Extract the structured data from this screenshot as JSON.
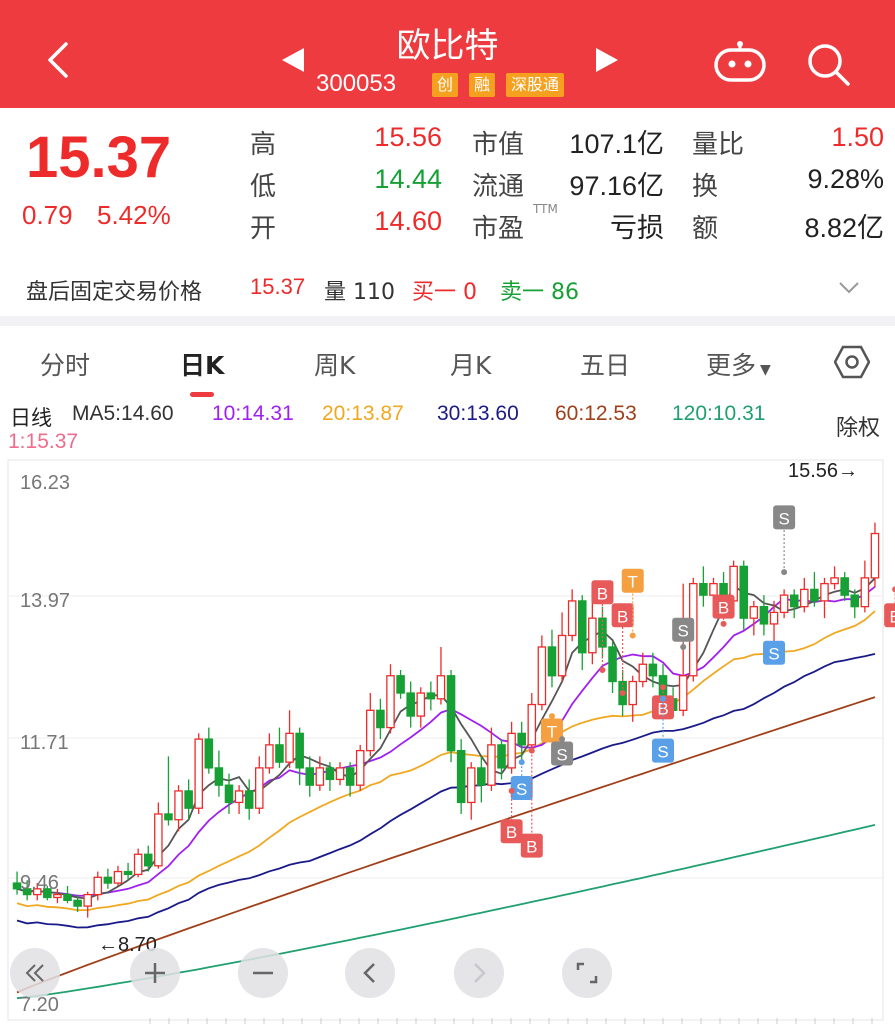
{
  "header": {
    "title": "欧比特",
    "code": "300053",
    "tags": [
      "创",
      "融",
      "深股通"
    ]
  },
  "quote": {
    "price": "15.37",
    "change": "0.79",
    "change_pct": "5.42%",
    "high_label": "高",
    "high": "15.56",
    "low_label": "低",
    "low": "14.44",
    "open_label": "开",
    "open": "14.60",
    "mktcap_label": "市值",
    "mktcap": "107.1亿",
    "float_label": "流通",
    "float": "97.16亿",
    "pe_label": "市盈",
    "pe_sup": "TTM",
    "pe": "亏损",
    "volratio_label": "量比",
    "volratio": "1.50",
    "turnover_label": "换",
    "turnover": "9.28%",
    "amount_label": "额",
    "amount": "8.82亿"
  },
  "after_hours": {
    "label": "盘后固定交易价格",
    "price": "15.37",
    "vol_label": "量 110",
    "buy1": "买一 0",
    "sell1": "卖一 86"
  },
  "tabs": [
    "分时",
    "日K",
    "周K",
    "月K",
    "五日",
    "更多"
  ],
  "active_tab": "日K",
  "ma_legend": {
    "period": "日线",
    "ma5": "MA5:14.60",
    "ma10": "10:14.31",
    "ma20": "20:13.87",
    "ma30": "30:13.60",
    "ma60": "60:12.53",
    "ma120": "120:10.31",
    "ma1": "1:15.37",
    "adjust": "除权"
  },
  "colors": {
    "up": "#ee2b2b",
    "down": "#17a035",
    "ma5": "#555555",
    "ma10": "#a020f0",
    "ma20": "#f0a820",
    "ma30": "#1a1a8a",
    "ma60": "#a0401a",
    "ma120": "#20a070",
    "ma1": "#ee6c8c"
  },
  "chart_data": {
    "type": "candlestick",
    "y_tick_labels": [
      "16.23",
      "13.97",
      "11.71",
      "9.46",
      "7.20"
    ],
    "ylim": [
      7.2,
      16.23
    ],
    "max_label": "15.56→",
    "min_label": "←8.70",
    "signal_markers": [
      "B",
      "S",
      "T"
    ],
    "candles": [
      [
        9.3,
        9.2,
        9.5,
        9.1
      ],
      [
        9.2,
        9.1,
        9.35,
        9.0
      ],
      [
        9.1,
        9.2,
        9.3,
        9.0
      ],
      [
        9.2,
        9.05,
        9.25,
        9.0
      ],
      [
        9.05,
        9.1,
        9.2,
        8.95
      ],
      [
        9.1,
        9.0,
        9.25,
        8.95
      ],
      [
        9.0,
        8.9,
        9.1,
        8.8
      ],
      [
        8.9,
        9.1,
        9.15,
        8.7
      ],
      [
        9.1,
        9.4,
        9.5,
        9.0
      ],
      [
        9.4,
        9.3,
        9.55,
        9.2
      ],
      [
        9.3,
        9.5,
        9.6,
        9.25
      ],
      [
        9.5,
        9.45,
        9.65,
        9.35
      ],
      [
        9.45,
        9.8,
        9.9,
        9.4
      ],
      [
        9.8,
        9.6,
        9.95,
        9.5
      ],
      [
        9.6,
        10.5,
        10.7,
        9.55
      ],
      [
        10.5,
        10.4,
        11.5,
        10.3
      ],
      [
        10.4,
        10.9,
        11.0,
        10.2
      ],
      [
        10.9,
        10.6,
        11.1,
        10.4
      ],
      [
        10.6,
        11.8,
        11.9,
        10.5
      ],
      [
        11.8,
        11.3,
        12.0,
        11.2
      ],
      [
        11.3,
        11.0,
        11.6,
        10.8
      ],
      [
        11.0,
        10.7,
        11.2,
        10.5
      ],
      [
        10.7,
        10.9,
        11.0,
        10.5
      ],
      [
        10.9,
        10.6,
        11.1,
        10.4
      ],
      [
        10.6,
        11.3,
        11.5,
        10.5
      ],
      [
        11.3,
        11.7,
        11.9,
        11.2
      ],
      [
        11.7,
        11.4,
        12.0,
        11.3
      ],
      [
        11.4,
        11.9,
        12.3,
        11.3
      ],
      [
        11.9,
        11.3,
        12.0,
        11.0
      ],
      [
        11.3,
        11.0,
        11.5,
        10.8
      ],
      [
        11.0,
        11.3,
        11.5,
        10.9
      ],
      [
        11.3,
        11.1,
        11.4,
        10.9
      ],
      [
        11.1,
        11.3,
        11.4,
        11.0
      ],
      [
        11.3,
        11.0,
        11.4,
        10.8
      ],
      [
        11.0,
        11.6,
        11.7,
        10.9
      ],
      [
        11.6,
        12.3,
        12.6,
        11.5
      ],
      [
        12.3,
        12.0,
        12.5,
        11.8
      ],
      [
        12.0,
        12.9,
        13.1,
        11.9
      ],
      [
        12.9,
        12.6,
        13.0,
        12.5
      ],
      [
        12.6,
        12.2,
        12.8,
        12.0
      ],
      [
        12.2,
        12.6,
        12.7,
        12.0
      ],
      [
        12.6,
        12.5,
        12.8,
        12.3
      ],
      [
        12.5,
        12.9,
        13.4,
        12.4
      ],
      [
        12.9,
        11.6,
        13.0,
        11.4
      ],
      [
        11.6,
        10.7,
        11.8,
        10.5
      ],
      [
        10.7,
        11.3,
        11.4,
        10.4
      ],
      [
        11.3,
        11.0,
        11.5,
        10.7
      ],
      [
        11.0,
        11.7,
        12.0,
        10.9
      ],
      [
        11.7,
        11.3,
        11.8,
        11.1
      ],
      [
        11.3,
        11.9,
        12.1,
        11.2
      ],
      [
        11.9,
        11.7,
        12.1,
        11.4
      ],
      [
        11.7,
        12.4,
        12.6,
        11.6
      ],
      [
        12.4,
        13.4,
        13.6,
        12.3
      ],
      [
        13.4,
        12.9,
        13.7,
        12.7
      ],
      [
        12.9,
        13.6,
        14.0,
        12.8
      ],
      [
        13.6,
        14.2,
        14.4,
        13.5
      ],
      [
        14.2,
        13.3,
        14.3,
        13.0
      ],
      [
        13.3,
        13.9,
        14.2,
        13.1
      ],
      [
        13.9,
        13.4,
        14.1,
        13.2
      ],
      [
        13.4,
        12.8,
        13.5,
        12.6
      ],
      [
        12.8,
        12.4,
        13.0,
        12.2
      ],
      [
        12.4,
        12.8,
        12.9,
        12.1
      ],
      [
        12.8,
        13.1,
        13.3,
        12.7
      ],
      [
        13.1,
        12.9,
        13.3,
        12.7
      ],
      [
        12.9,
        12.5,
        13.1,
        12.4
      ],
      [
        12.5,
        12.3,
        12.7,
        12.2
      ],
      [
        12.3,
        12.9,
        14.5,
        12.2
      ],
      [
        12.9,
        14.5,
        14.6,
        12.8
      ],
      [
        14.5,
        14.3,
        14.8,
        14.1
      ],
      [
        14.3,
        14.5,
        14.6,
        14.1
      ],
      [
        14.5,
        14.2,
        14.7,
        14.0
      ],
      [
        14.2,
        14.8,
        14.9,
        14.1
      ],
      [
        14.8,
        13.9,
        14.9,
        13.7
      ],
      [
        13.9,
        14.1,
        14.2,
        13.6
      ],
      [
        14.1,
        13.8,
        14.3,
        13.6
      ],
      [
        13.8,
        14.0,
        14.2,
        13.5
      ],
      [
        14.0,
        14.3,
        14.4,
        13.9
      ],
      [
        14.3,
        14.1,
        14.4,
        13.9
      ],
      [
        14.1,
        14.4,
        14.6,
        14.0
      ],
      [
        14.4,
        14.2,
        14.7,
        14.1
      ],
      [
        14.2,
        14.5,
        14.6,
        13.9
      ],
      [
        14.5,
        14.6,
        14.8,
        14.4
      ],
      [
        14.6,
        14.3,
        14.7,
        14.2
      ],
      [
        14.3,
        14.1,
        14.4,
        13.9
      ],
      [
        14.1,
        14.6,
        14.9,
        14.0
      ],
      [
        14.6,
        15.37,
        15.56,
        14.44
      ]
    ]
  }
}
